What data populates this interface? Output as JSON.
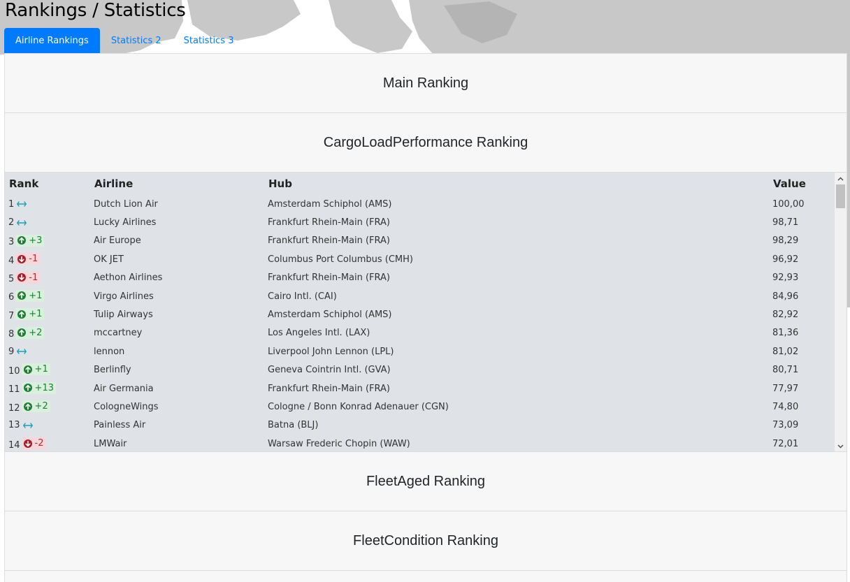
{
  "page": {
    "title": "Rankings / Statistics"
  },
  "tabs": [
    {
      "label": "Airline Rankings",
      "active": true
    },
    {
      "label": "Statistics 2",
      "active": false
    },
    {
      "label": "Statistics 3",
      "active": false
    }
  ],
  "sections": {
    "main": "Main Ranking",
    "cargo": "CargoLoadPerformance Ranking",
    "fleet_aged": "FleetAged Ranking",
    "fleet_condition": "FleetCondition Ranking"
  },
  "table": {
    "headers": {
      "rank": "Rank",
      "airline": "Airline",
      "hub": "Hub",
      "value": "Value"
    },
    "rows": [
      {
        "rank": "1",
        "change": "",
        "trend": "same",
        "airline": "Dutch Lion Air",
        "hub": "Amsterdam Schiphol (AMS)",
        "value": "100,00"
      },
      {
        "rank": "2",
        "change": "",
        "trend": "same",
        "airline": "Lucky Airlines",
        "hub": "Frankfurt Rhein-Main (FRA)",
        "value": "98,71"
      },
      {
        "rank": "3",
        "change": "+3",
        "trend": "up",
        "airline": "Air Europe",
        "hub": "Frankfurt Rhein-Main (FRA)",
        "value": "98,29"
      },
      {
        "rank": "4",
        "change": "-1",
        "trend": "down",
        "airline": "OK JET",
        "hub": "Columbus Port Columbus (CMH)",
        "value": "96,92"
      },
      {
        "rank": "5",
        "change": "-1",
        "trend": "down",
        "airline": "Aethon Airlines",
        "hub": "Frankfurt Rhein-Main (FRA)",
        "value": "92,93"
      },
      {
        "rank": "6",
        "change": "+1",
        "trend": "up",
        "airline": "Virgo Airlines",
        "hub": "Cairo Intl. (CAI)",
        "value": "84,96"
      },
      {
        "rank": "7",
        "change": "+1",
        "trend": "up",
        "airline": "Tulip Airways",
        "hub": "Amsterdam Schiphol (AMS)",
        "value": "82,92"
      },
      {
        "rank": "8",
        "change": "+2",
        "trend": "up",
        "airline": "mccartney",
        "hub": "Los Angeles Intl. (LAX)",
        "value": "81,36"
      },
      {
        "rank": "9",
        "change": "",
        "trend": "same",
        "airline": "lennon",
        "hub": "Liverpool John Lennon (LPL)",
        "value": "81,02"
      },
      {
        "rank": "10",
        "change": "+1",
        "trend": "up",
        "airline": "Berlinfly",
        "hub": "Geneva Cointrin Intl. (GVA)",
        "value": "80,71"
      },
      {
        "rank": "11",
        "change": "+13",
        "trend": "up",
        "airline": "Air Germania",
        "hub": "Frankfurt Rhein-Main (FRA)",
        "value": "77,97"
      },
      {
        "rank": "12",
        "change": "+2",
        "trend": "up",
        "airline": "CologneWings",
        "hub": "Cologne / Bonn Konrad Adenauer (CGN)",
        "value": "74,80"
      },
      {
        "rank": "13",
        "change": "",
        "trend": "same",
        "airline": "Painless Air",
        "hub": "Batna (BLJ)",
        "value": "73,09"
      },
      {
        "rank": "14",
        "change": "-2",
        "trend": "down",
        "airline": "LMWair",
        "hub": "Warsaw Frederic Chopin (WAW)",
        "value": "72,01"
      }
    ]
  },
  "colors": {
    "accent": "#007bff",
    "up": "#1e7e34",
    "down": "#a71d2a",
    "same": "#17a2b8",
    "table_bg": "#dfe3e7"
  }
}
